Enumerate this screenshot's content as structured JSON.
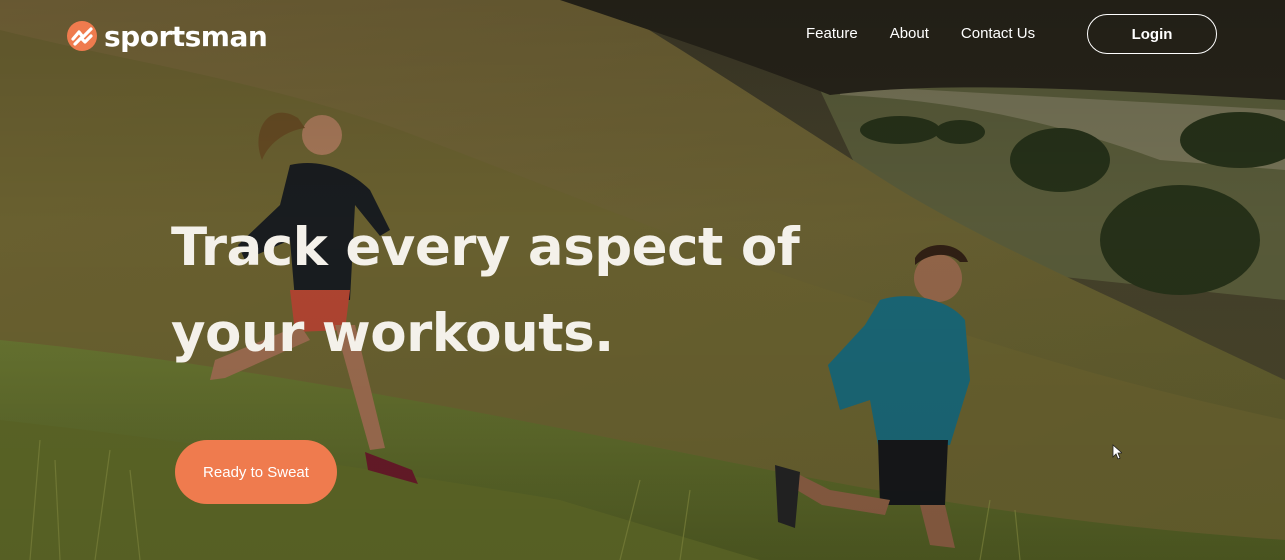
{
  "nav": {
    "brand": "sportsman",
    "links": [
      "Feature",
      "About",
      "Contact Us"
    ],
    "login_label": "Login"
  },
  "hero": {
    "headline": "Track every aspect of your workouts.",
    "cta_label": "Ready to Sweat"
  },
  "colors": {
    "accent": "#ef7b4e",
    "text": "#ffffff",
    "hill_grass": "#8a7a3c",
    "jacket_teal": "#1f7a8c"
  },
  "icons": [
    "logo-mark-icon",
    "mouse-cursor-icon"
  ]
}
